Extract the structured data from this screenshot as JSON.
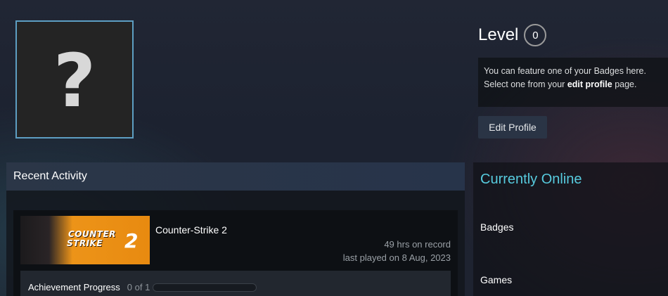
{
  "avatar": {
    "glyph": "?"
  },
  "level": {
    "label": "Level",
    "value": "0"
  },
  "badge_note": {
    "line1": "You can feature one of your Badges here.",
    "line2_prefix": "Select one from your ",
    "line2_link": "edit profile",
    "line2_suffix": " page."
  },
  "edit_profile_label": "Edit Profile",
  "recent_activity": {
    "title": "Recent Activity",
    "game": {
      "name": "Counter-Strike 2",
      "capsule_line1": "COUNTER",
      "capsule_line2": "STRIKE",
      "capsule_number": "2",
      "hours": "49 hrs on record",
      "last_played": "last played on 8 Aug, 2023",
      "achievement_label": "Achievement Progress",
      "achievement_count": "0 of 1",
      "achievement_fraction": 0
    }
  },
  "sidebar": {
    "status": "Currently Online",
    "badges_label": "Badges",
    "games_label": "Games"
  },
  "colors": {
    "status_online": "#57cbde",
    "avatar_border": "#5d9ec2",
    "capsule_orange": "#f09a1e"
  }
}
